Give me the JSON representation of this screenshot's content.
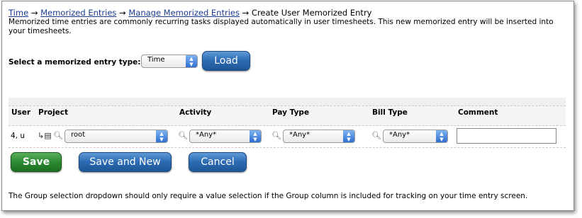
{
  "breadcrumb": {
    "items": [
      "Time",
      "Memorized Entries",
      "Manage Memorized Entries"
    ],
    "separator": "→",
    "current": "Create User Memorized Entry"
  },
  "intro_text": "Memorized time entries are commonly recurring tasks displayed automatically in user timesheets. This new memorized entry will be inserted into your timesheets.",
  "entry_type": {
    "label": "Select a memorized entry type:",
    "selected": "Time",
    "load_button": "Load"
  },
  "table": {
    "headers": [
      "User",
      "Project",
      "Activity",
      "Pay Type",
      "Bill Type",
      "Comment"
    ],
    "row": {
      "user": "4, u",
      "project": "root",
      "activity": "*Any*",
      "pay_type": "*Any*",
      "bill_type": "*Any*",
      "comment": ""
    }
  },
  "buttons": {
    "save": "Save",
    "save_and_new": "Save and New",
    "cancel": "Cancel"
  },
  "footer_note": "The Group selection dropdown should only require a value selection if the Group column is included for tracking on your time entry screen.",
  "colors": {
    "link": "#1c3c92",
    "blue_button": "#2b6ab2",
    "green_button": "#2c8a31"
  }
}
